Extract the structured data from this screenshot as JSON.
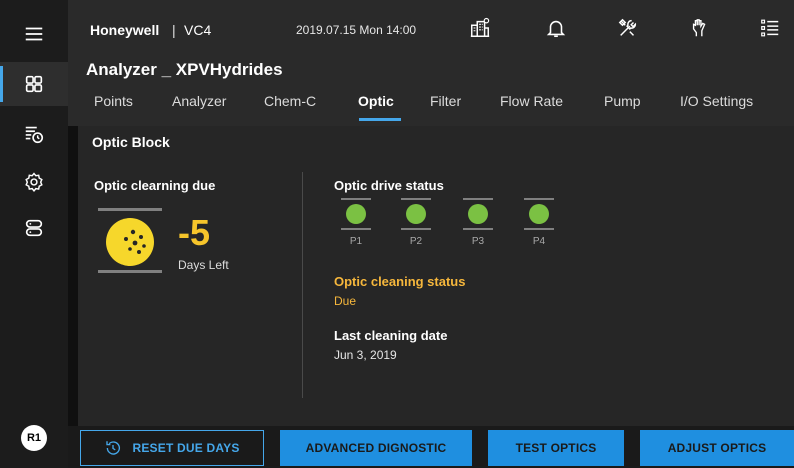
{
  "header": {
    "brand": "Honeywell",
    "separator": "|",
    "device": "VC4",
    "datetime": "2019.07.15 Mon 14:00",
    "icons": [
      "network-icon",
      "bell-icon",
      "tools-icon",
      "hand-icon",
      "list-icon"
    ]
  },
  "sidebar": {
    "items": [
      {
        "icon": "menu-icon"
      },
      {
        "icon": "dashboard-icon",
        "active": true
      },
      {
        "icon": "schedule-list-icon"
      },
      {
        "icon": "settings-icon"
      },
      {
        "icon": "device-icon"
      }
    ],
    "user_badge": "R1"
  },
  "page": {
    "title": "Analyzer _ XPVHydrides",
    "tabs": [
      {
        "label": "Points"
      },
      {
        "label": "Analyzer"
      },
      {
        "label": "Chem-C"
      },
      {
        "label": "Optic",
        "active": true
      },
      {
        "label": "Filter"
      },
      {
        "label": "Flow Rate"
      },
      {
        "label": "Pump"
      },
      {
        "label": "I/O Settings"
      }
    ]
  },
  "optic_block": {
    "title": "Optic Block",
    "cleaning_due": {
      "title": "Optic clearning due",
      "value": "-5",
      "unit_label": "Days Left"
    },
    "drive_status": {
      "title": "Optic drive status",
      "drives": [
        {
          "label": "P1",
          "status": "ok"
        },
        {
          "label": "P2",
          "status": "ok"
        },
        {
          "label": "P3",
          "status": "ok"
        },
        {
          "label": "P4",
          "status": "ok"
        }
      ]
    },
    "cleaning_status": {
      "title": "Optic cleaning status",
      "value": "Due"
    },
    "last_cleaning": {
      "title": "Last cleaning date",
      "value": "Jun 3, 2019"
    }
  },
  "actions": {
    "reset_due_days": "RESET DUE DAYS",
    "advanced_diagnostic": "ADVANCED DIGNOSTIC",
    "test_optics": "TEST OPTICS",
    "adjust_optics": "ADJUST OPTICS"
  },
  "colors": {
    "accent": "#45a7ea",
    "warning": "#f6b73c",
    "gauge": "#f6d72b",
    "ok": "#7bc143"
  }
}
